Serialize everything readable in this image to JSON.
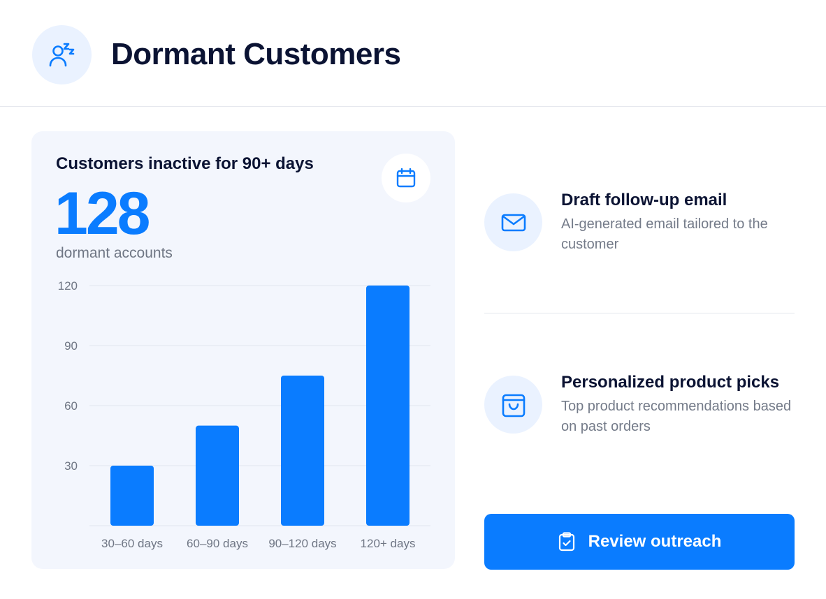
{
  "header": {
    "title": "Dormant Customers",
    "icon": "sleeping-user-icon"
  },
  "card": {
    "title": "Customers inactive for 90+ days",
    "badge_icon": "calendar-icon",
    "metric_value": "128",
    "metric_caption": "dormant accounts"
  },
  "chart_data": {
    "type": "bar",
    "categories": [
      "30–60 days",
      "60–90 days",
      "90–120 days",
      "120+ days"
    ],
    "values": [
      30,
      50,
      75,
      120
    ],
    "ylim": [
      0,
      120
    ],
    "yticks": [
      30,
      60,
      90,
      120
    ],
    "grid": true,
    "color": "#0a7cff",
    "title": "",
    "xlabel": "",
    "ylabel": ""
  },
  "actions": [
    {
      "title": "Draft follow-up email",
      "description": "AI-generated email tailored to the customer",
      "icon": "mail-icon"
    },
    {
      "title": "Personalized product picks",
      "description": "Top product recommendations based on past orders",
      "icon": "shopping-bag-icon"
    }
  ],
  "cta": {
    "label": "Review outreach",
    "icon": "clipboard-check-icon"
  },
  "colors": {
    "accent": "#0a7cff",
    "accent_soft": "#eaf2ff",
    "card_bg": "#f3f6fd",
    "text_dark": "#0b1333",
    "text_muted": "#747b89"
  }
}
